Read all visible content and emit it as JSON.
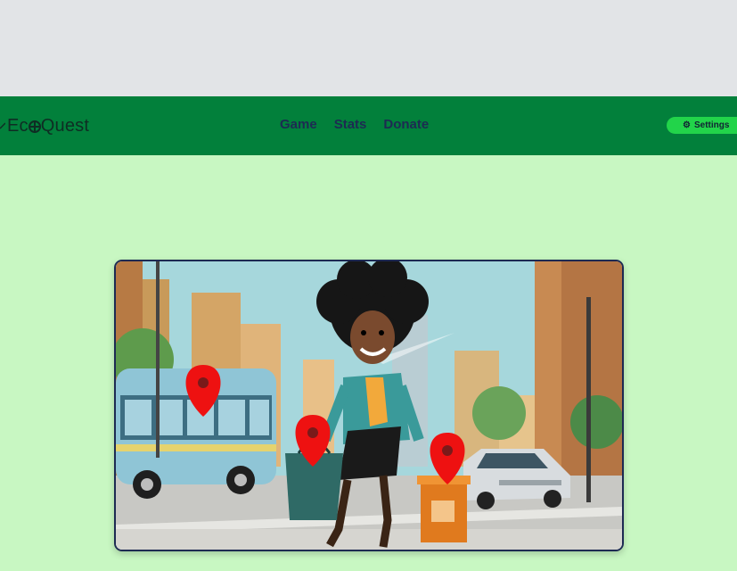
{
  "header": {
    "logo_text_pre": "Ec",
    "logo_text_post": "Quest",
    "nav": [
      {
        "label": "Game"
      },
      {
        "label": "Stats"
      },
      {
        "label": "Donate"
      }
    ],
    "settings_label": "Settings"
  },
  "colors": {
    "top_band": "#e2e4e7",
    "navbar": "#02803b",
    "page_bg": "#c8f7c2",
    "settings_button": "#22d44a",
    "pin": "#ee1111"
  },
  "hero": {
    "description_icons": [
      "bus",
      "woman-with-bag",
      "recycling-bin",
      "car",
      "map-pin-icon"
    ]
  }
}
